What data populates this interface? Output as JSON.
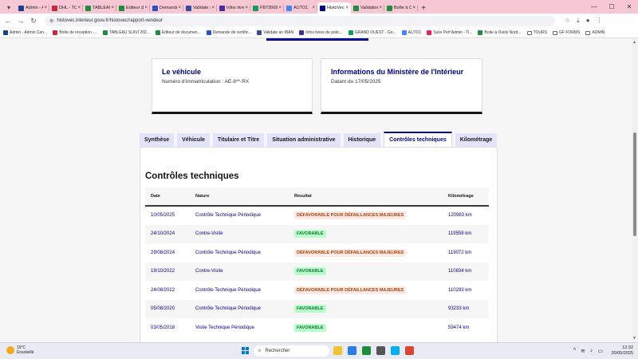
{
  "browser": {
    "tabs": [
      {
        "label": "Admin - Adi",
        "color": "#1a3f8f",
        "active": false
      },
      {
        "label": "DHL - TOUR",
        "color": "#c5283d",
        "active": false
      },
      {
        "label": "TABLEAU SU",
        "color": "#1e8e3e",
        "active": false
      },
      {
        "label": "Editeur de d",
        "color": "#1e8e3e",
        "active": false
      },
      {
        "label": "Demande de",
        "color": "#2a50c8",
        "active": false
      },
      {
        "label": "Validate an",
        "color": "#3c4a9e",
        "active": false
      },
      {
        "label": "Infos livres d",
        "color": "#4b2a9e",
        "active": false
      },
      {
        "label": "FB72669 - É",
        "color": "#0f9d58",
        "active": false
      },
      {
        "label": "AUTO1",
        "color": "#4285f4",
        "active": false
      },
      {
        "label": "HistoVec - R",
        "color": "#000091",
        "active": true
      },
      {
        "label": "Validations",
        "color": "#1e8e3e",
        "active": false
      },
      {
        "label": "Boîte à Outil",
        "color": "#1e8e3e",
        "active": false
      }
    ],
    "url": "histovec.interieur.gouv.fr/histovec/rapport-vendeur",
    "bookmarks": [
      {
        "label": "Admin - Admin Cen...",
        "color": "#1a3f8f"
      },
      {
        "label": "Boîte de réception -...",
        "color": "#c5283d"
      },
      {
        "label": "TABLEAU SUIVI 202...",
        "color": "#1e8e3e"
      },
      {
        "label": "Editeur de documen...",
        "color": "#1e8e3e"
      },
      {
        "label": "Demande de certific...",
        "color": "#2a50c8"
      },
      {
        "label": "Validate an IBAN",
        "color": "#3c4a9e"
      },
      {
        "label": "Infos livres de polic...",
        "color": "#4b2a9e"
      },
      {
        "label": "GRAND OUEST - Go...",
        "color": "#0f9d58"
      },
      {
        "label": "AUTO1",
        "color": "#4285f4"
      },
      {
        "label": "Suivi Perf Admin - Ti...",
        "color": "#e91e63"
      },
      {
        "label": "Boite à Outils Nord...",
        "color": "#1e8e3e"
      },
      {
        "label": "TOURS",
        "color": "folder"
      },
      {
        "label": "GF FORMS",
        "color": "folder"
      },
      {
        "label": "ADMIN",
        "color": "folder"
      }
    ]
  },
  "vehicle_card": {
    "title": "Le véhicule",
    "plate_text": "Numéro d'immatriculation : AE-8**-RX"
  },
  "ministry_card": {
    "title": "Informations du Ministère de l'Intérieur",
    "date_text": "Datant du 17/05/2025"
  },
  "page_tabs": [
    {
      "label": "Synthèse",
      "active": false
    },
    {
      "label": "Véhicule",
      "active": false
    },
    {
      "label": "Titulaire et Titre",
      "active": false
    },
    {
      "label": "Situation administrative",
      "active": false
    },
    {
      "label": "Historique",
      "active": false
    },
    {
      "label": "Contrôles techniques",
      "active": true
    },
    {
      "label": "Kilométrage",
      "active": false
    }
  ],
  "section_title": "Contrôles techniques",
  "table": {
    "headers": [
      "Date",
      "Nature",
      "Résultat",
      "Kilométrage"
    ],
    "rows": [
      {
        "date": "10/05/2025",
        "nature": "Contrôle Technique Périodique",
        "result": "DÉFAVORABLE POUR DÉFAILLANCES MAJEURES",
        "status": "bad",
        "km": "120983 km"
      },
      {
        "date": "24/10/2024",
        "nature": "Contre-Visite",
        "result": "FAVORABLE",
        "status": "good",
        "km": "119558 km"
      },
      {
        "date": "29/08/2024",
        "nature": "Contrôle Technique Périodique",
        "result": "DÉFAVORABLE POUR DÉFAILLANCES MAJEURES",
        "status": "bad",
        "km": "119072 km"
      },
      {
        "date": "19/10/2022",
        "nature": "Contre-Visite",
        "result": "FAVORABLE",
        "status": "good",
        "km": "110834 km"
      },
      {
        "date": "24/08/2022",
        "nature": "Contrôle Technique Périodique",
        "result": "DÉFAVORABLE POUR DÉFAILLANCES MAJEURES",
        "status": "bad",
        "km": "110293 km"
      },
      {
        "date": "05/08/2020",
        "nature": "Contrôle Technique Périodique",
        "result": "FAVORABLE",
        "status": "good",
        "km": "93233 km"
      },
      {
        "date": "03/05/2018",
        "nature": "Visite Technique Périodique",
        "result": "FAVORABLE",
        "status": "good",
        "km": "59474 km"
      }
    ]
  },
  "taskbar": {
    "temperature": "19°C",
    "weather": "Ensoleillé",
    "search_placeholder": "Rechercher",
    "time": "12:32",
    "date": "20/05/2025",
    "apps": [
      {
        "name": "file-explorer-icon",
        "color": "#f4c430"
      },
      {
        "name": "browser-icon",
        "color": "#2b7de9"
      },
      {
        "name": "media-icon",
        "color": "#1e8e3e"
      },
      {
        "name": "store-icon",
        "color": "#555555"
      },
      {
        "name": "skype-icon",
        "color": "#00aff0"
      },
      {
        "name": "chrome-icon",
        "color": "#db4437"
      }
    ]
  }
}
